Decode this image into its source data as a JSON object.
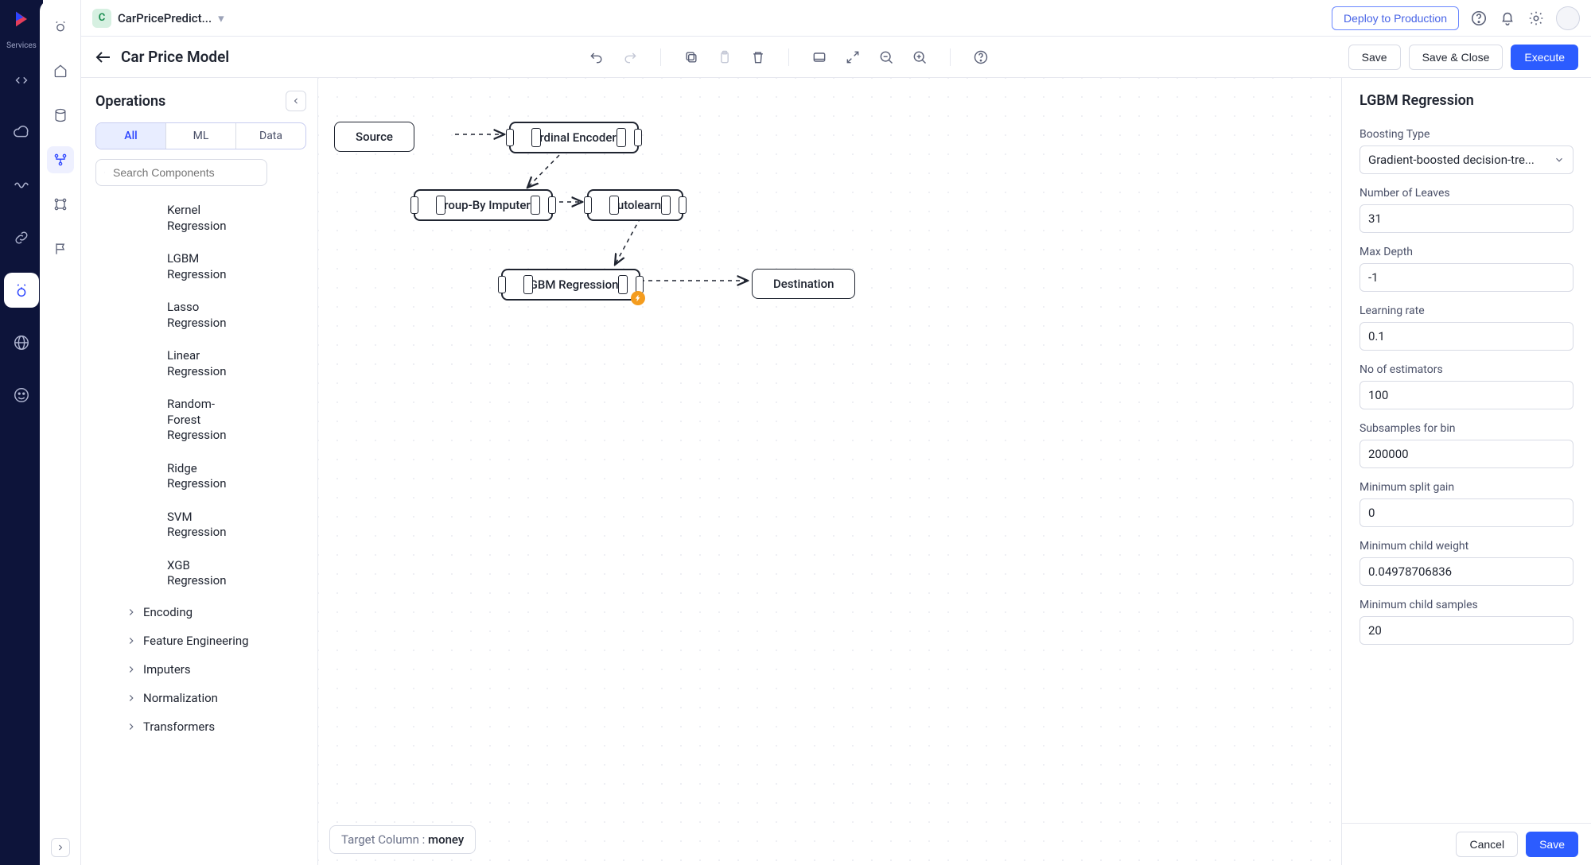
{
  "rail": {
    "services_label": "Services"
  },
  "topbar": {
    "project_initial": "C",
    "project_name": "CarPricePredict...",
    "deploy": "Deploy to Production"
  },
  "toolbar": {
    "title": "Car Price Model",
    "save": "Save",
    "save_close": "Save & Close",
    "execute": "Execute"
  },
  "ops": {
    "title": "Operations",
    "tabs": {
      "all": "All",
      "ml": "ML",
      "data": "Data"
    },
    "search_placeholder": "Search Components",
    "items": [
      "Kernel Regression",
      "LGBM Regression",
      "Lasso Regression",
      "Linear Regression",
      "Random-Forest Regression",
      "Ridge Regression",
      "SVM Regression",
      "XGB Regression"
    ],
    "groups": [
      "Encoding",
      "Feature Engineering",
      "Imputers",
      "Normalization",
      "Transformers"
    ]
  },
  "canvas": {
    "nodes": {
      "source": "Source",
      "ord_enc": "Ordinal Encoder",
      "groupby": "Group-By Imputer",
      "autolearn": "Autolearn",
      "lgbm": "LGBM Regression",
      "dest": "Destination"
    },
    "target_label": "Target Column :",
    "target_value": "money"
  },
  "rpanel": {
    "title": "LGBM Regression",
    "fields": {
      "boosting_type": {
        "label": "Boosting Type",
        "value": "Gradient-boosted decision-tre..."
      },
      "num_leaves": {
        "label": "Number of Leaves",
        "value": "31"
      },
      "max_depth": {
        "label": "Max Depth",
        "value": "-1"
      },
      "learning_rate": {
        "label": "Learning rate",
        "value": "0.1"
      },
      "n_estimators": {
        "label": "No of estimators",
        "value": "100"
      },
      "subsamples_bin": {
        "label": "Subsamples for bin",
        "value": "200000"
      },
      "min_split_gain": {
        "label": "Minimum split gain",
        "value": "0"
      },
      "min_child_weight": {
        "label": "Minimum child weight",
        "value": "0.04978706836"
      },
      "min_child_samples": {
        "label": "Minimum child samples",
        "value": "20"
      }
    },
    "cancel": "Cancel",
    "save": "Save"
  }
}
